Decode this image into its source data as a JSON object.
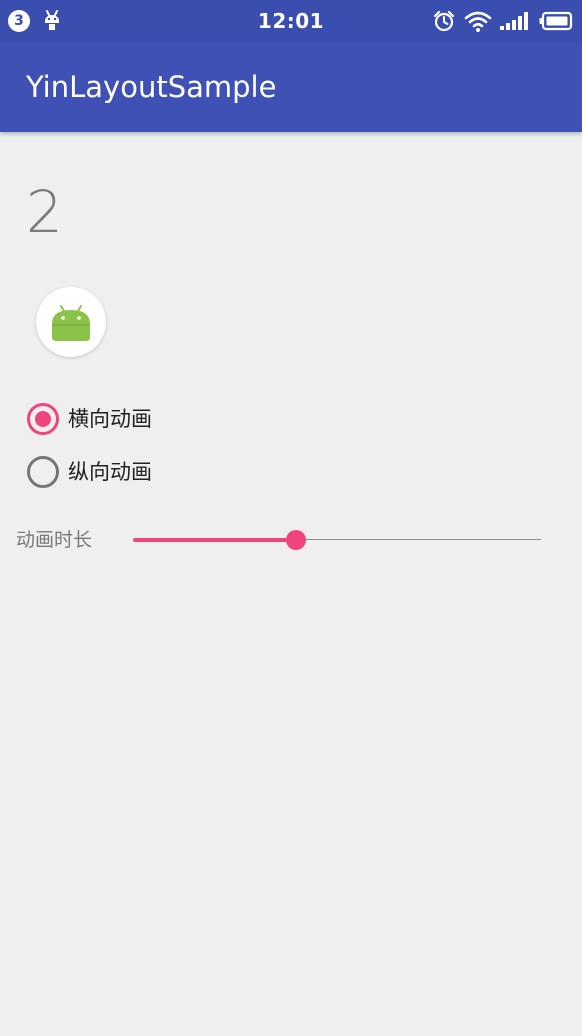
{
  "status_bar": {
    "notification_count": "3",
    "time": "12:01",
    "icons": [
      "android-debug-icon",
      "alarm-icon",
      "wifi-icon",
      "cellular-signal-icon",
      "battery-icon"
    ]
  },
  "app_bar": {
    "title": "YinLayoutSample"
  },
  "counter": {
    "value": "2"
  },
  "avatar": {
    "icon": "android-robot-icon"
  },
  "animation_direction": {
    "options": [
      {
        "label": "横向动画",
        "selected": true
      },
      {
        "label": "纵向动画",
        "selected": false
      }
    ]
  },
  "duration": {
    "label": "动画时长",
    "progress": 0.4
  },
  "colors": {
    "primary": "#3f51b5",
    "primary_dark": "#3a4eb0",
    "accent": "#f0457c",
    "background": "#efefef",
    "android_green": "#8bc34a"
  }
}
